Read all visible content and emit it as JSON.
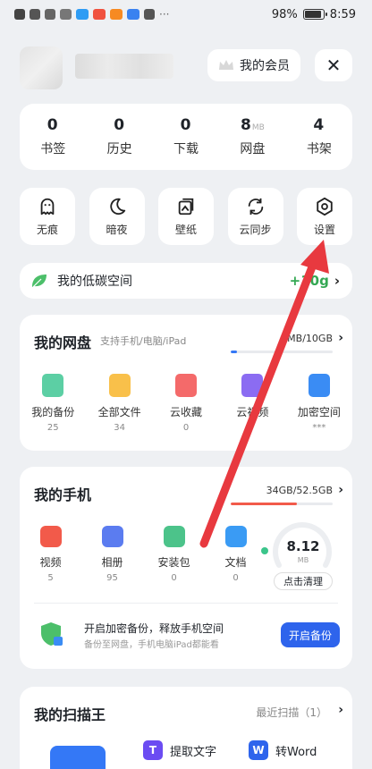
{
  "status": {
    "battery": "98%",
    "time": "8:59"
  },
  "header": {
    "vip_label": "我的会员",
    "close_glyph": "✕"
  },
  "stats": [
    {
      "value": "0",
      "unit": "",
      "label": "书签"
    },
    {
      "value": "0",
      "unit": "",
      "label": "历史"
    },
    {
      "value": "0",
      "unit": "",
      "label": "下载"
    },
    {
      "value": "8",
      "unit": "MB",
      "label": "网盘"
    },
    {
      "value": "4",
      "unit": "",
      "label": "书架"
    }
  ],
  "tools": [
    {
      "label": "无痕",
      "icon": "ghost-icon"
    },
    {
      "label": "暗夜",
      "icon": "moon-icon"
    },
    {
      "label": "壁纸",
      "icon": "wallpaper-icon"
    },
    {
      "label": "云同步",
      "icon": "sync-icon"
    },
    {
      "label": "设置",
      "icon": "settings-icon"
    }
  ],
  "carbon": {
    "label": "我的低碳空间",
    "value": "+10g"
  },
  "disk": {
    "title": "我的网盘",
    "subtitle": "支持手机/电脑/iPad",
    "capacity": "8MB/10GB",
    "usage_fraction": 0.06,
    "items": [
      {
        "label": "我的备份",
        "count": "25",
        "color": "#5ccfa4"
      },
      {
        "label": "全部文件",
        "count": "34",
        "color": "#f9c04a"
      },
      {
        "label": "云收藏",
        "count": "0",
        "color": "#f46a6a"
      },
      {
        "label": "云视频",
        "count": "",
        "color": "#8b6cf2"
      },
      {
        "label": "加密空间",
        "count": "***",
        "color": "#3a8cf4"
      }
    ]
  },
  "phone": {
    "title": "我的手机",
    "capacity": "34GB/52.5GB",
    "usage_fraction": 0.65,
    "items": [
      {
        "label": "视频",
        "count": "5",
        "color": "#f25a4a"
      },
      {
        "label": "相册",
        "count": "95",
        "color": "#5b7cf0"
      },
      {
        "label": "安装包",
        "count": "0",
        "color": "#4cc38a"
      },
      {
        "label": "文档",
        "count": "0",
        "color": "#3a9bf4"
      }
    ],
    "junk_value": "8.12",
    "junk_unit": "MB",
    "clean_label": "点击清理",
    "backup_title": "开启加密备份，释放手机空间",
    "backup_sub": "备份至网盘，手机电脑iPad都能看",
    "backup_button": "开启备份"
  },
  "scanner": {
    "title": "我的扫描王",
    "recent": "最近扫描（1）",
    "items": [
      {
        "label": "提取文字",
        "glyph": "T",
        "color": "#6b4cf2"
      },
      {
        "label": "转Word",
        "glyph": "W",
        "color": "#2e64ec"
      }
    ]
  },
  "colors": {
    "accent": "#2e64ec",
    "annotation_arrow": "#e8393f",
    "green": "#34a853"
  }
}
